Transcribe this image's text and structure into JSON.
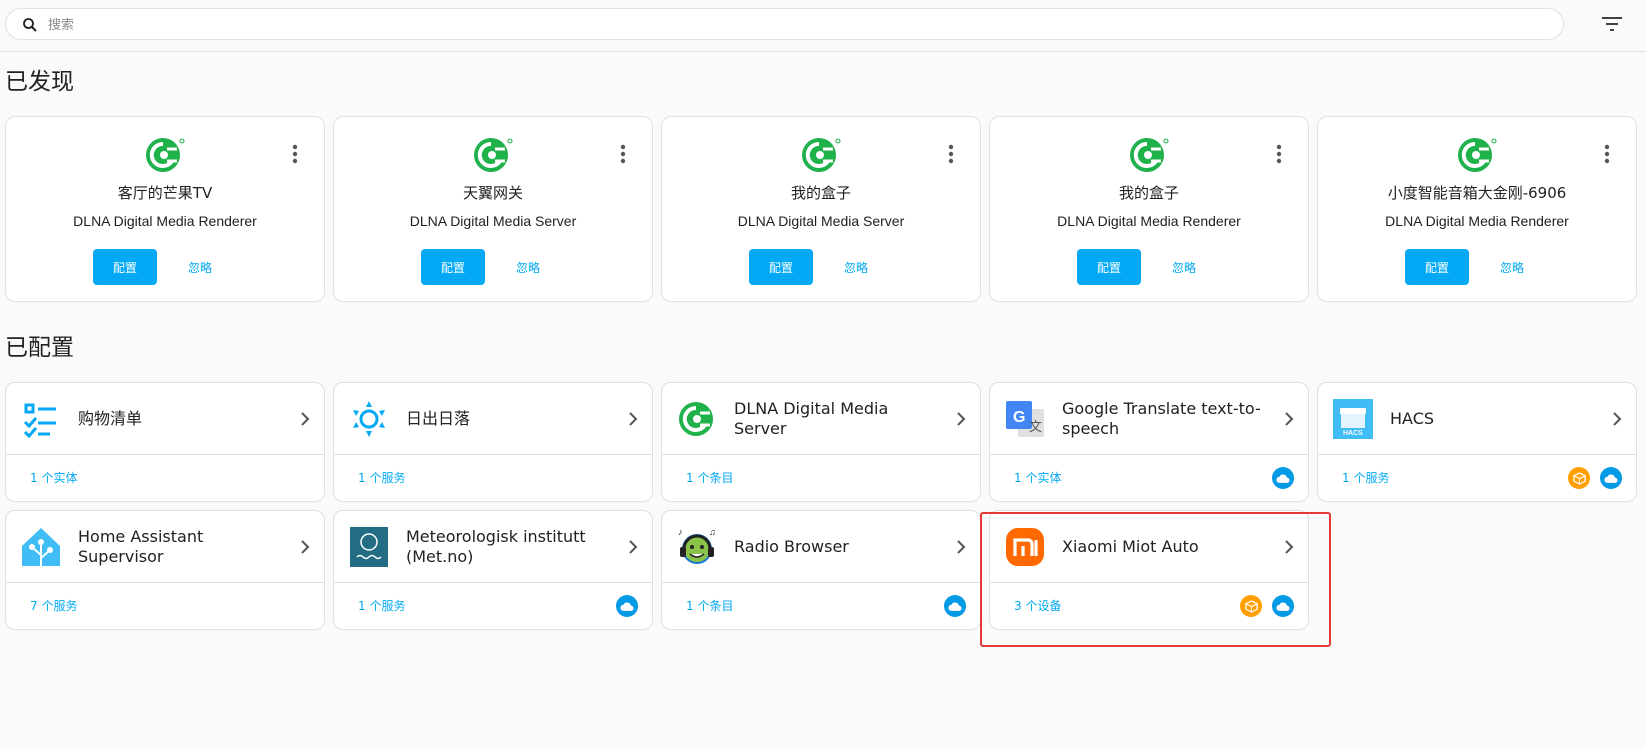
{
  "search": {
    "placeholder": "搜索"
  },
  "sections": {
    "discovered": "已发现",
    "configured": "已配置"
  },
  "buttons": {
    "configure": "配置",
    "ignore": "忽略"
  },
  "discovered": [
    {
      "name": "客厅的芒果TV",
      "subtitle": "DLNA Digital Media Renderer"
    },
    {
      "name": "天翼网关",
      "subtitle": "DLNA Digital Media Server"
    },
    {
      "name": "我的盒子",
      "subtitle": "DLNA Digital Media Server"
    },
    {
      "name": "我的盒子",
      "subtitle": "DLNA Digital Media Renderer"
    },
    {
      "name": "小度智能音箱大金刚-6906",
      "subtitle": "DLNA Digital Media Renderer"
    }
  ],
  "configured": [
    {
      "name": "购物清单",
      "link": "1 个实体",
      "icon": "checklist-icon",
      "badges": []
    },
    {
      "name": "日出日落",
      "link": "1 个服务",
      "icon": "sun-icon",
      "badges": []
    },
    {
      "name": "DLNA Digital Media Server",
      "link": "1 个条目",
      "icon": "dlna-logo-icon",
      "badges": []
    },
    {
      "name": "Google Translate text-to-speech",
      "link": "1 个实体",
      "icon": "google-translate-icon",
      "badges": [
        "cloud"
      ]
    },
    {
      "name": "HACS",
      "link": "1 个服务",
      "icon": "hacs-icon",
      "badges": [
        "custom",
        "cloud"
      ]
    },
    {
      "name": "Home Assistant Supervisor",
      "link": "7 个服务",
      "icon": "home-assistant-icon",
      "badges": []
    },
    {
      "name": "Meteorologisk institutt (Met.no)",
      "link": "1 个服务",
      "icon": "met-no-icon",
      "badges": [
        "cloud"
      ]
    },
    {
      "name": "Radio Browser",
      "link": "1 个条目",
      "icon": "radio-browser-icon",
      "badges": [
        "cloud"
      ]
    },
    {
      "name": "Xiaomi Miot Auto",
      "link": "3 个设备",
      "icon": "xiaomi-icon",
      "badges": [
        "custom",
        "cloud"
      ]
    }
  ],
  "colors": {
    "accent": "#03a9f4",
    "dlna_green": "#1fb24a",
    "xiaomi_orange": "#ff6900",
    "custom_badge": "#ffa000",
    "highlight": "#e53935"
  }
}
